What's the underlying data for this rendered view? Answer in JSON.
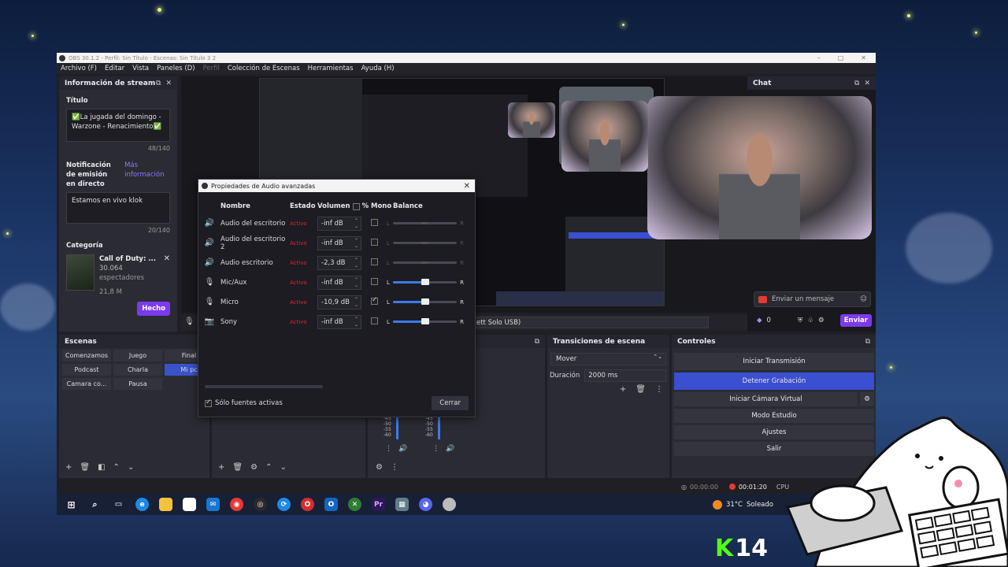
{
  "window": {
    "title": "OBS 30.1.2 - Perfil: Sin Título - Escenas: Sin Título 3 2",
    "menu": [
      "Archivo (F)",
      "Editar",
      "Vista",
      "Paneles (D)",
      "Perfil",
      "Colección de Escenas",
      "Herramientas",
      "Ayuda (H)"
    ]
  },
  "stream_info": {
    "header": "Información de stream",
    "title_label": "Título",
    "title_value": "✅La jugada del domingo - Warzone - Renacimiento✅",
    "title_count": "48/140",
    "notif_label": "Notificación de emisión en directo",
    "more_info": "Más información",
    "notif_value": "Estamos en vivo klok",
    "notif_count": "20/140",
    "category_label": "Categoría",
    "game_name": "Call of Duty: ...",
    "viewers": "30.064",
    "viewers_label": "espectadores",
    "followers": "21,8 M",
    "done_button": "Hecho"
  },
  "chat": {
    "header": "Chat",
    "input_placeholder": "Enviar un mensaje",
    "points": "0",
    "send_button": "Enviar"
  },
  "audio_dialog": {
    "title": "Propiedades de Audio avanzadas",
    "headers": {
      "name": "Nombre",
      "state": "Estado",
      "volume": "Volumen",
      "percent": "%",
      "mono": "Mono",
      "balance": "Balance"
    },
    "rows": [
      {
        "name": "Audio del escritorio",
        "state": "Activo",
        "volume": "-inf dB",
        "mono": false,
        "balance_active": false,
        "balance": 0.5
      },
      {
        "name": "Audio del escritorio 2",
        "state": "Activo",
        "volume": "-inf dB",
        "mono": false,
        "balance_active": false,
        "balance": 0.5
      },
      {
        "name": "Audio escritorio",
        "state": "Activo",
        "volume": "-2,3 dB",
        "mono": false,
        "balance_active": false,
        "balance": 0.5
      },
      {
        "name": "Mic/Aux",
        "state": "Activo",
        "volume": "-inf dB",
        "mono": false,
        "balance_active": true,
        "balance": 0.5
      },
      {
        "name": "Micro",
        "state": "Activo",
        "volume": "-10,9 dB",
        "mono": true,
        "balance_active": true,
        "balance": 0.5
      },
      {
        "name": "Sony",
        "state": "Activo",
        "volume": "-inf dB",
        "mono": false,
        "balance_active": true,
        "balance": 0.5
      }
    ],
    "balance_left": "L",
    "balance_right": "R",
    "only_active": "Sólo fuentes activas",
    "close_button": "Cerrar"
  },
  "source_bar": {
    "device": "ett Solo USB)"
  },
  "scenes": {
    "header": "Escenas",
    "items": [
      "Comenzamos",
      "Juego",
      "Final",
      "Podcast",
      "Charla",
      "Mi pc",
      "Camara co...",
      "Pausa"
    ],
    "active": "Mi pc"
  },
  "transitions": {
    "header": "Transiciones de escena",
    "type": "Mover",
    "duration_label": "Duración",
    "duration_value": "2000 ms"
  },
  "controls": {
    "header": "Controles",
    "buttons": [
      "Iniciar Transmisión",
      "Detener Grabación",
      "Iniciar Cámara Virtual",
      "Modo Estudio",
      "Ajustes",
      "Salir"
    ]
  },
  "status": {
    "stream_time": "00:00:00",
    "rec_time": "00:01:20",
    "cpu": "CPU"
  },
  "mixer_scale": [
    "-45",
    "-50",
    "-55",
    "-60"
  ],
  "taskbar": {
    "temp": "31°C",
    "weather": "Soleado"
  },
  "overlay": {
    "kick_number": "14"
  },
  "colors": {
    "accent_blue": "#3b4fd1",
    "purple": "#7c3aed",
    "kick_green": "#53fc18",
    "red_state": "#d92a2a"
  }
}
